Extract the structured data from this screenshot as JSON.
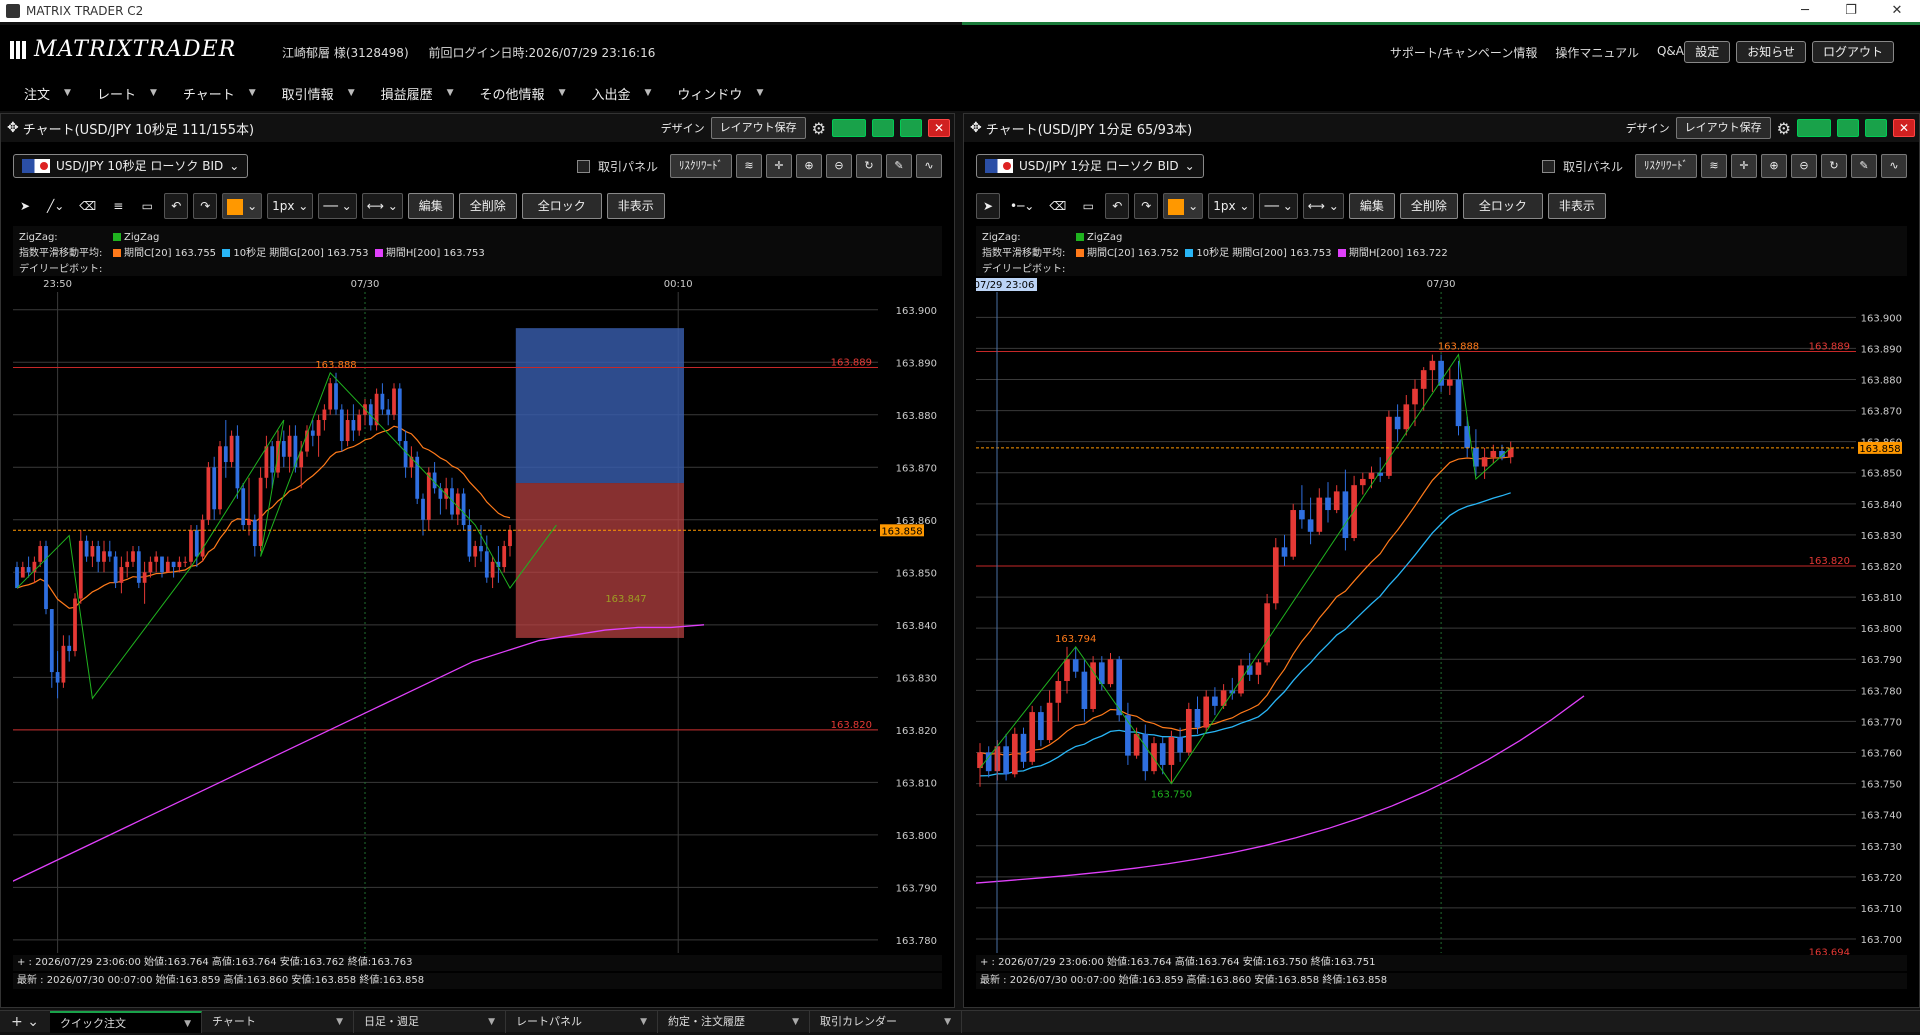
{
  "app": {
    "title": "MATRIX TRADER C2",
    "logo": "MATRIXTRADER"
  },
  "user": {
    "name": "江崎郁層 様(3128498)",
    "last_login": "前回ログイン日時:2026/07/29 23:16:16"
  },
  "header_links": [
    "サポート/キャンペーン情報",
    "操作マニュアル",
    "Q&A"
  ],
  "header_buttons": [
    "設定",
    "お知らせ",
    "ログアウト"
  ],
  "menu": [
    "注文",
    "レート",
    "チャート",
    "取引情報",
    "損益履歴",
    "その他情報",
    "入出金",
    "ウィンドウ"
  ],
  "common": {
    "design": "デザイン",
    "layout_save": "レイアウト保存",
    "trade_panel": "取引パネル",
    "risk_reward": "ﾘｽｸﾘﾜｰﾄﾞ",
    "linewidth": "1px",
    "edit": "編集",
    "delete_all": "全削除",
    "lock_all": "全ロック",
    "hide": "非表示",
    "zigzag_label": "ZigZag:",
    "zigzag_name": "ZigZag",
    "ema_label": "指数平滑移動平均:",
    "pivot_label": "デイリーピボット:"
  },
  "left": {
    "title": "チャート(USD/JPY 10秒足 111/155本)",
    "symbol": "USD/JPY 10秒足 ローソク BID",
    "ema": [
      "期間C[20] 163.755",
      "10秒足 期間G[200] 163.753",
      "期間H[200] 163.753"
    ],
    "x_ticks": [
      {
        "t": "23:50",
        "i": 7
      },
      {
        "t": "07/30",
        "i": 60
      },
      {
        "t": "00:10",
        "i": 114
      }
    ],
    "info1": "+ : 2026/07/29 23:06:00  始値:163.764  高値:163.764  安値:163.762  終値:163.763",
    "info2": "最新 : 2026/07/30 00:07:00  始値:163.859  高値:163.860  安値:163.858  終値:163.858"
  },
  "right": {
    "title": "チャート(USD/JPY 1分足 65/93本)",
    "symbol": "USD/JPY 1分足 ローソク BID",
    "ema": [
      "期間C[20] 163.752",
      "10秒足 期間G[200] 163.753",
      "期間H[200] 163.722"
    ],
    "x_ticks": [
      {
        "t": "07/30",
        "i": 53
      }
    ],
    "crosshair_label": "07/29 23:06",
    "info1": "+ : 2026/07/29 23:06:00  始値:163.764  高値:163.764  安値:163.750  終値:163.751",
    "info2": "最新 : 2026/07/30 00:07:00  始値:163.859  高値:163.860  安値:163.858  終値:163.858"
  },
  "bottom_tabs": [
    "クイック注文",
    "チャート",
    "日足・週足",
    "レートパネル",
    "約定・注文履歴",
    "取引カレンダー"
  ],
  "chart_data": [
    {
      "type": "candlestick",
      "title": "USD/JPY 10秒足",
      "y_ticks": [
        163.9,
        163.89,
        163.88,
        163.87,
        163.86,
        163.85,
        163.84,
        163.83,
        163.82,
        163.81,
        163.8,
        163.79,
        163.78
      ],
      "ylim": [
        163.7775,
        163.903
      ],
      "current_price": 163.858,
      "pivot_lines": [
        {
          "value": 163.889,
          "label": "163.889"
        },
        {
          "value": 163.82,
          "label": "163.820"
        }
      ],
      "zigzag_labels": [
        {
          "value": 163.888,
          "label": "163.888",
          "i": 55
        },
        {
          "value": 163.847,
          "label": "163.847",
          "i": 105
        }
      ],
      "risk_reward_box": {
        "x_from_index": 86,
        "x_to_index": 115,
        "top": 163.8965,
        "mid": 163.867,
        "bottom": 163.8375
      },
      "ema20": [
        163.838,
        163.837,
        163.836,
        163.835,
        163.834,
        163.834,
        163.834,
        163.835,
        163.836,
        163.838,
        163.839,
        163.841,
        163.843,
        163.845,
        163.846,
        163.847,
        163.848,
        163.849,
        163.849,
        163.849,
        163.85,
        163.851,
        163.852,
        163.853,
        163.855,
        163.857,
        163.858,
        163.859,
        163.86,
        163.861,
        163.862,
        163.864,
        163.866,
        163.868,
        163.869,
        163.869,
        163.868,
        163.867,
        163.867,
        163.868,
        163.87,
        163.872,
        163.874,
        163.874,
        163.874,
        163.876,
        163.877,
        163.877,
        163.878,
        163.879,
        163.879,
        163.88,
        163.88,
        163.88,
        163.88,
        163.879,
        163.877,
        163.875,
        163.873,
        163.872,
        163.87,
        163.869,
        163.868,
        163.866,
        163.865,
        163.864,
        163.864,
        163.863,
        163.862,
        163.861,
        163.86,
        163.859,
        163.858,
        163.857,
        163.857,
        163.857,
        163.856
      ],
      "ema20_start_index": 0,
      "ema200_a": [
        163.791,
        163.794,
        163.797,
        163.8,
        163.803,
        163.806,
        163.809,
        163.812,
        163.815,
        163.818,
        163.821,
        163.824,
        163.827,
        163.83,
        163.833,
        163.835,
        163.837,
        163.838,
        163.839,
        163.8395
      ],
      "ema200_step": 6,
      "candles": [
        [
          163.851,
          163.852,
          163.848,
          163.847
        ],
        [
          163.849,
          163.852,
          163.849,
          163.851
        ],
        [
          163.851,
          163.853,
          163.849,
          163.85
        ],
        [
          163.85,
          163.853,
          163.848,
          163.852
        ],
        [
          163.852,
          163.856,
          163.851,
          163.855
        ],
        [
          163.855,
          163.856,
          163.842,
          163.843
        ],
        [
          163.843,
          163.843,
          163.828,
          163.831
        ],
        [
          163.831,
          163.835,
          163.826,
          163.829
        ],
        [
          163.829,
          163.838,
          163.828,
          163.836
        ],
        [
          163.836,
          163.838,
          163.833,
          163.835
        ],
        [
          163.835,
          163.846,
          163.834,
          163.845
        ],
        [
          163.845,
          163.858,
          163.844,
          163.856
        ],
        [
          163.856,
          163.857,
          163.852,
          163.853
        ],
        [
          163.853,
          163.856,
          163.851,
          163.855
        ],
        [
          163.855,
          163.856,
          163.85,
          163.852
        ],
        [
          163.852,
          163.856,
          163.85,
          163.854
        ],
        [
          163.854,
          163.856,
          163.852,
          163.853
        ],
        [
          163.853,
          163.854,
          163.847,
          163.848
        ],
        [
          163.848,
          163.853,
          163.846,
          163.851
        ],
        [
          163.851,
          163.854,
          163.849,
          163.852
        ],
        [
          163.852,
          163.855,
          163.851,
          163.854
        ],
        [
          163.854,
          163.855,
          163.847,
          163.848
        ],
        [
          163.848,
          163.852,
          163.844,
          163.85
        ],
        [
          163.85,
          163.853,
          163.849,
          163.852
        ],
        [
          163.852,
          163.854,
          163.85,
          163.853
        ],
        [
          163.853,
          163.853,
          163.849,
          163.85
        ],
        [
          163.85,
          163.853,
          163.85,
          163.852
        ],
        [
          163.852,
          163.852,
          163.849,
          163.851
        ],
        [
          163.851,
          163.853,
          163.85,
          163.852
        ],
        [
          163.852,
          163.853,
          163.851,
          163.852
        ],
        [
          163.852,
          163.859,
          163.851,
          163.858
        ],
        [
          163.858,
          163.859,
          163.851,
          163.853
        ],
        [
          163.853,
          163.861,
          163.852,
          163.86
        ],
        [
          163.86,
          163.871,
          163.859,
          163.87
        ],
        [
          163.87,
          163.872,
          163.86,
          163.862
        ],
        [
          163.862,
          163.875,
          163.861,
          163.874
        ],
        [
          163.874,
          163.879,
          163.868,
          163.871
        ],
        [
          163.871,
          163.877,
          163.87,
          163.876
        ],
        [
          163.876,
          163.878,
          163.864,
          163.866
        ],
        [
          163.866,
          163.867,
          163.858,
          163.859
        ],
        [
          163.859,
          163.868,
          163.857,
          163.86
        ],
        [
          163.86,
          163.861,
          163.853,
          163.855
        ],
        [
          163.855,
          163.87,
          163.854,
          163.868
        ],
        [
          163.868,
          163.876,
          163.866,
          163.874
        ],
        [
          163.874,
          163.875,
          163.866,
          163.869
        ],
        [
          163.869,
          163.877,
          163.868,
          163.875
        ],
        [
          163.875,
          163.877,
          163.87,
          163.872
        ],
        [
          163.872,
          163.878,
          163.869,
          163.876
        ],
        [
          163.876,
          163.878,
          163.869,
          163.87
        ],
        [
          163.87,
          163.875,
          163.866,
          163.873
        ],
        [
          163.873,
          163.878,
          163.872,
          163.877
        ],
        [
          163.877,
          163.879,
          163.874,
          163.876
        ],
        [
          163.876,
          163.88,
          163.872,
          163.879
        ],
        [
          163.879,
          163.882,
          163.877,
          163.881
        ],
        [
          163.881,
          163.887,
          163.88,
          163.886
        ],
        [
          163.886,
          163.888,
          163.88,
          163.881
        ],
        [
          163.881,
          163.882,
          163.873,
          163.875
        ],
        [
          163.875,
          163.881,
          163.874,
          163.879
        ],
        [
          163.879,
          163.882,
          163.875,
          163.877
        ],
        [
          163.877,
          163.881,
          163.876,
          163.88
        ],
        [
          163.88,
          163.883,
          163.878,
          163.882
        ],
        [
          163.882,
          163.883,
          163.877,
          163.878
        ],
        [
          163.878,
          163.885,
          163.877,
          163.884
        ],
        [
          163.884,
          163.886,
          163.88,
          163.881
        ],
        [
          163.881,
          163.883,
          163.878,
          163.88
        ],
        [
          163.88,
          163.886,
          163.879,
          163.885
        ],
        [
          163.885,
          163.886,
          163.874,
          163.875
        ],
        [
          163.875,
          163.877,
          163.868,
          163.87
        ],
        [
          163.87,
          163.874,
          163.868,
          163.872
        ],
        [
          163.872,
          163.873,
          163.863,
          163.864
        ],
        [
          163.864,
          163.865,
          163.857,
          163.86
        ],
        [
          163.86,
          163.87,
          163.858,
          163.869
        ],
        [
          163.869,
          163.871,
          163.865,
          163.866
        ],
        [
          163.866,
          163.867,
          163.861,
          163.864
        ],
        [
          163.864,
          163.868,
          163.862,
          163.866
        ],
        [
          163.866,
          163.868,
          163.86,
          163.861
        ],
        [
          163.861,
          163.866,
          163.859,
          163.865
        ],
        [
          163.865,
          163.866,
          163.858,
          163.859
        ],
        [
          163.859,
          163.862,
          163.852,
          163.853
        ],
        [
          163.853,
          163.856,
          163.851,
          163.855
        ],
        [
          163.855,
          163.859,
          163.852,
          163.854
        ],
        [
          163.854,
          163.857,
          163.848,
          163.849
        ],
        [
          163.849,
          163.853,
          163.847,
          163.852
        ],
        [
          163.852,
          163.855,
          163.848,
          163.851
        ],
        [
          163.851,
          163.856,
          163.85,
          163.855
        ],
        [
          163.855,
          163.859,
          163.853,
          163.858
        ]
      ]
    },
    {
      "type": "candlestick",
      "title": "USD/JPY 1分足",
      "y_ticks": [
        163.9,
        163.89,
        163.88,
        163.87,
        163.86,
        163.85,
        163.84,
        163.83,
        163.82,
        163.81,
        163.8,
        163.79,
        163.78,
        163.77,
        163.76,
        163.75,
        163.74,
        163.73,
        163.72,
        163.71,
        163.7
      ],
      "ylim": [
        163.6955,
        163.9075
      ],
      "current_price": 163.858,
      "pivot_lines": [
        {
          "value": 163.889,
          "label": "163.889"
        },
        {
          "value": 163.82,
          "label": "163.820"
        },
        {
          "value": 163.694,
          "label": "163.694"
        }
      ],
      "zigzag_labels": [
        {
          "value": 163.794,
          "label": "163.794",
          "i": 11
        },
        {
          "value": 163.75,
          "label": "163.750",
          "i": 22
        },
        {
          "value": 163.888,
          "label": "163.888",
          "i": 55
        }
      ],
      "candles": [
        [
          163.755,
          163.763,
          163.749,
          163.76
        ],
        [
          163.76,
          163.762,
          163.752,
          163.754
        ],
        [
          163.754,
          163.764,
          163.751,
          163.762
        ],
        [
          163.762,
          163.766,
          163.751,
          163.753
        ],
        [
          163.753,
          163.768,
          163.752,
          163.766
        ],
        [
          163.766,
          163.768,
          163.755,
          163.757
        ],
        [
          163.757,
          163.775,
          163.756,
          163.773
        ],
        [
          163.773,
          163.775,
          163.762,
          163.764
        ],
        [
          163.764,
          163.78,
          163.763,
          163.776
        ],
        [
          163.776,
          163.786,
          163.77,
          163.783
        ],
        [
          163.783,
          163.794,
          163.779,
          163.79
        ],
        [
          163.79,
          163.794,
          163.784,
          163.786
        ],
        [
          163.786,
          163.79,
          163.77,
          163.774
        ],
        [
          163.774,
          163.791,
          163.773,
          163.789
        ],
        [
          163.789,
          163.791,
          163.78,
          163.782
        ],
        [
          163.782,
          163.792,
          163.781,
          163.79
        ],
        [
          163.79,
          163.791,
          163.77,
          163.772
        ],
        [
          163.772,
          163.776,
          163.756,
          163.759
        ],
        [
          163.759,
          163.768,
          163.758,
          163.766
        ],
        [
          163.766,
          163.769,
          163.751,
          163.754
        ],
        [
          163.754,
          163.765,
          163.753,
          163.763
        ],
        [
          163.763,
          163.765,
          163.753,
          163.756
        ],
        [
          163.756,
          163.767,
          163.75,
          163.765
        ],
        [
          163.765,
          163.768,
          163.757,
          163.76
        ],
        [
          163.76,
          163.776,
          163.759,
          163.774
        ],
        [
          163.774,
          163.778,
          163.766,
          163.768
        ],
        [
          163.768,
          163.78,
          163.767,
          163.778
        ],
        [
          163.778,
          163.781,
          163.772,
          163.775
        ],
        [
          163.775,
          163.782,
          163.774,
          163.78
        ],
        [
          163.78,
          163.784,
          163.777,
          163.779
        ],
        [
          163.779,
          163.79,
          163.778,
          163.788
        ],
        [
          163.788,
          163.792,
          163.783,
          163.785
        ],
        [
          163.785,
          163.79,
          163.782,
          163.789
        ],
        [
          163.789,
          163.811,
          163.788,
          163.808
        ],
        [
          163.808,
          163.829,
          163.806,
          163.826
        ],
        [
          163.826,
          163.83,
          163.82,
          163.823
        ],
        [
          163.823,
          163.84,
          163.822,
          163.838
        ],
        [
          163.838,
          163.846,
          163.832,
          163.835
        ],
        [
          163.835,
          163.842,
          163.827,
          163.831
        ],
        [
          163.831,
          163.845,
          163.83,
          163.842
        ],
        [
          163.842,
          163.847,
          163.834,
          163.838
        ],
        [
          163.838,
          163.846,
          163.837,
          163.844
        ],
        [
          163.844,
          163.851,
          163.825,
          163.829
        ],
        [
          163.829,
          163.849,
          163.828,
          163.846
        ],
        [
          163.846,
          163.85,
          163.843,
          163.848
        ],
        [
          163.848,
          163.852,
          163.845,
          163.85
        ],
        [
          163.85,
          163.855,
          163.847,
          163.849
        ],
        [
          163.849,
          163.87,
          163.848,
          163.868
        ],
        [
          163.868,
          163.872,
          163.86,
          163.864
        ],
        [
          163.864,
          163.875,
          163.862,
          163.872
        ],
        [
          163.872,
          163.88,
          163.865,
          163.877
        ],
        [
          163.877,
          163.884,
          163.87,
          163.883
        ],
        [
          163.883,
          163.888,
          163.876,
          163.886
        ],
        [
          163.886,
          163.888,
          163.876,
          163.878
        ],
        [
          163.878,
          163.884,
          163.875,
          163.88
        ],
        [
          163.88,
          163.886,
          163.862,
          163.865
        ],
        [
          163.865,
          163.868,
          163.855,
          163.858
        ],
        [
          163.858,
          163.864,
          163.849,
          163.852
        ],
        [
          163.852,
          163.858,
          163.848,
          163.855
        ],
        [
          163.855,
          163.859,
          163.853,
          163.857
        ],
        [
          163.857,
          163.859,
          163.854,
          163.855
        ],
        [
          163.855,
          163.86,
          163.853,
          163.858
        ]
      ]
    }
  ]
}
